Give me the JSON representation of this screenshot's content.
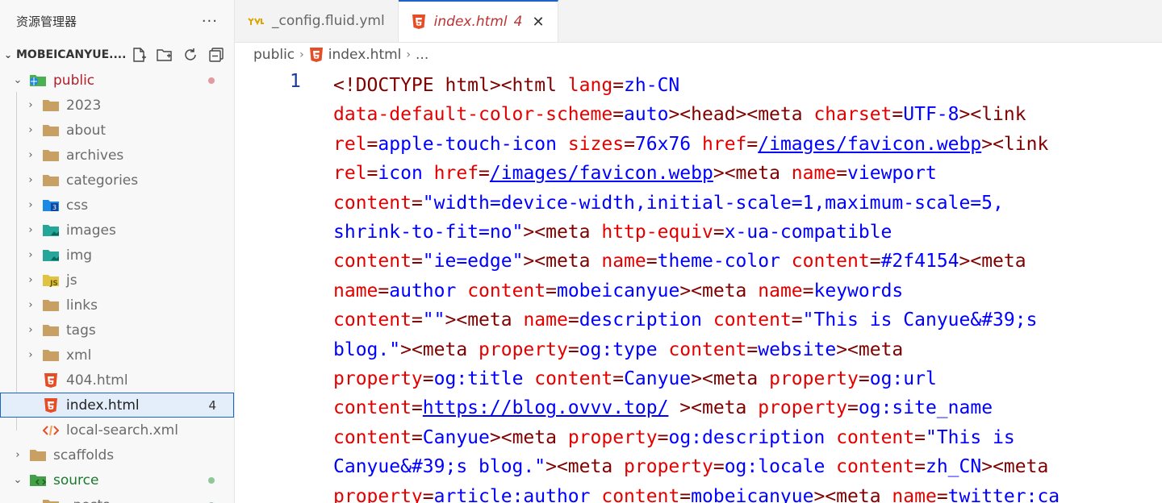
{
  "sidebar": {
    "title": "资源管理器",
    "more": "···",
    "root": {
      "name": "MOBEICANYUE...."
    },
    "items": [
      {
        "label": "public",
        "chev": "⌄",
        "icon": "folder-public-icon",
        "color": "#b31d28",
        "dot": "#e09aa0"
      },
      {
        "label": "2023",
        "chev": "›",
        "icon": "folder-icon"
      },
      {
        "label": "about",
        "chev": "›",
        "icon": "folder-icon"
      },
      {
        "label": "archives",
        "chev": "›",
        "icon": "folder-icon"
      },
      {
        "label": "categories",
        "chev": "›",
        "icon": "folder-icon"
      },
      {
        "label": "css",
        "chev": "›",
        "icon": "folder-css-icon"
      },
      {
        "label": "images",
        "chev": "›",
        "icon": "folder-images-icon"
      },
      {
        "label": "img",
        "chev": "›",
        "icon": "folder-images-icon"
      },
      {
        "label": "js",
        "chev": "›",
        "icon": "folder-js-icon"
      },
      {
        "label": "links",
        "chev": "›",
        "icon": "folder-icon"
      },
      {
        "label": "tags",
        "chev": "›",
        "icon": "folder-icon"
      },
      {
        "label": "xml",
        "chev": "›",
        "icon": "folder-icon"
      },
      {
        "label": "404.html",
        "chev": "",
        "icon": "html5-icon"
      },
      {
        "label": "index.html",
        "chev": "",
        "icon": "html5-icon",
        "count": "4",
        "selected": true
      },
      {
        "label": "local-search.xml",
        "chev": "",
        "icon": "xml-icon"
      },
      {
        "label": "scaffolds",
        "chev": "›",
        "icon": "folder-icon"
      },
      {
        "label": "source",
        "chev": "⌄",
        "icon": "folder-source-icon",
        "color": "#1b7a2e",
        "dot": "#8fc79b"
      },
      {
        "label": "_posts",
        "chev": "⌄",
        "icon": "folder-icon",
        "dot": "#8fc79b"
      }
    ]
  },
  "tabs": [
    {
      "label": "_config.fluid.yml",
      "icon": "yaml-icon"
    },
    {
      "label": "index.html",
      "icon": "html5-icon",
      "count": "4",
      "close": "✕",
      "active": true
    }
  ],
  "breadcrumb": {
    "folder": "public",
    "file": "index.html",
    "tail": "..."
  },
  "editor": {
    "line_number": "1",
    "lines": [
      [
        [
          "tg",
          "<!DOCTYPE html><html "
        ],
        [
          "at",
          "lang"
        ],
        [
          "tg",
          "="
        ],
        [
          "vl",
          "zh-CN"
        ]
      ],
      [
        [
          "at",
          "data-default-color-scheme"
        ],
        [
          "tg",
          "="
        ],
        [
          "vl",
          "auto"
        ],
        [
          "tg",
          "><head><meta "
        ],
        [
          "at",
          "charset"
        ],
        [
          "tg",
          "="
        ],
        [
          "vl",
          "UTF-8"
        ],
        [
          "tg",
          "><link"
        ]
      ],
      [
        [
          "at",
          "rel"
        ],
        [
          "tg",
          "="
        ],
        [
          "vl",
          "apple-touch-icon "
        ],
        [
          "at",
          "sizes"
        ],
        [
          "tg",
          "="
        ],
        [
          "vl",
          "76x76 "
        ],
        [
          "at",
          "href"
        ],
        [
          "tg",
          "="
        ],
        [
          "lk",
          "/images/favicon.webp"
        ],
        [
          "tg",
          "><link"
        ]
      ],
      [
        [
          "at",
          "rel"
        ],
        [
          "tg",
          "="
        ],
        [
          "vl",
          "icon "
        ],
        [
          "at",
          "href"
        ],
        [
          "tg",
          "="
        ],
        [
          "lk",
          "/images/favicon.webp"
        ],
        [
          "tg",
          "><meta "
        ],
        [
          "at",
          "name"
        ],
        [
          "tg",
          "="
        ],
        [
          "vl",
          "viewport"
        ]
      ],
      [
        [
          "at",
          "content"
        ],
        [
          "tg",
          "="
        ],
        [
          "vl",
          "\"width=device-width,initial-scale=1,maximum-scale=5,"
        ]
      ],
      [
        [
          "vl",
          "shrink-to-fit=no\""
        ],
        [
          "tg",
          "><meta "
        ],
        [
          "at",
          "http-equiv"
        ],
        [
          "tg",
          "="
        ],
        [
          "vl",
          "x-ua-compatible"
        ]
      ],
      [
        [
          "at",
          "content"
        ],
        [
          "tg",
          "="
        ],
        [
          "vl",
          "\"ie=edge\""
        ],
        [
          "tg",
          "><meta "
        ],
        [
          "at",
          "name"
        ],
        [
          "tg",
          "="
        ],
        [
          "vl",
          "theme-color "
        ],
        [
          "at",
          "content"
        ],
        [
          "tg",
          "="
        ],
        [
          "vl",
          "#2f4154"
        ],
        [
          "tg",
          "><meta"
        ]
      ],
      [
        [
          "at",
          "name"
        ],
        [
          "tg",
          "="
        ],
        [
          "vl",
          "author "
        ],
        [
          "at",
          "content"
        ],
        [
          "tg",
          "="
        ],
        [
          "vl",
          "mobeicanyue"
        ],
        [
          "tg",
          "><meta "
        ],
        [
          "at",
          "name"
        ],
        [
          "tg",
          "="
        ],
        [
          "vl",
          "keywords"
        ]
      ],
      [
        [
          "at",
          "content"
        ],
        [
          "tg",
          "="
        ],
        [
          "vl",
          "\"\""
        ],
        [
          "tg",
          "><meta "
        ],
        [
          "at",
          "name"
        ],
        [
          "tg",
          "="
        ],
        [
          "vl",
          "description "
        ],
        [
          "at",
          "content"
        ],
        [
          "tg",
          "="
        ],
        [
          "vl",
          "\"This is Canyue&#39;s"
        ]
      ],
      [
        [
          "vl",
          "blog.\""
        ],
        [
          "tg",
          "><meta "
        ],
        [
          "at",
          "property"
        ],
        [
          "tg",
          "="
        ],
        [
          "vl",
          "og:type "
        ],
        [
          "at",
          "content"
        ],
        [
          "tg",
          "="
        ],
        [
          "vl",
          "website"
        ],
        [
          "tg",
          "><meta"
        ]
      ],
      [
        [
          "at",
          "property"
        ],
        [
          "tg",
          "="
        ],
        [
          "vl",
          "og:title "
        ],
        [
          "at",
          "content"
        ],
        [
          "tg",
          "="
        ],
        [
          "vl",
          "Canyue"
        ],
        [
          "tg",
          "><meta "
        ],
        [
          "at",
          "property"
        ],
        [
          "tg",
          "="
        ],
        [
          "vl",
          "og:url"
        ]
      ],
      [
        [
          "at",
          "content"
        ],
        [
          "tg",
          "="
        ],
        [
          "lk",
          "https://blog.ovvv.top/"
        ],
        [
          "vl",
          " "
        ],
        [
          "tg",
          "><meta "
        ],
        [
          "at",
          "property"
        ],
        [
          "tg",
          "="
        ],
        [
          "vl",
          "og:site_name"
        ]
      ],
      [
        [
          "at",
          "content"
        ],
        [
          "tg",
          "="
        ],
        [
          "vl",
          "Canyue"
        ],
        [
          "tg",
          "><meta "
        ],
        [
          "at",
          "property"
        ],
        [
          "tg",
          "="
        ],
        [
          "vl",
          "og:description "
        ],
        [
          "at",
          "content"
        ],
        [
          "tg",
          "="
        ],
        [
          "vl",
          "\"This is"
        ]
      ],
      [
        [
          "vl",
          "Canyue&#39;s blog.\""
        ],
        [
          "tg",
          "><meta "
        ],
        [
          "at",
          "property"
        ],
        [
          "tg",
          "="
        ],
        [
          "vl",
          "og:locale "
        ],
        [
          "at",
          "content"
        ],
        [
          "tg",
          "="
        ],
        [
          "vl",
          "zh_CN"
        ],
        [
          "tg",
          "><meta"
        ]
      ],
      [
        [
          "at",
          "property"
        ],
        [
          "tg",
          "="
        ],
        [
          "vl",
          "article:author "
        ],
        [
          "at",
          "content"
        ],
        [
          "tg",
          "="
        ],
        [
          "vl",
          "mobeicanyue"
        ],
        [
          "tg",
          "><meta "
        ],
        [
          "at",
          "name"
        ],
        [
          "tg",
          "="
        ],
        [
          "vl",
          "twitter:ca"
        ]
      ]
    ]
  }
}
